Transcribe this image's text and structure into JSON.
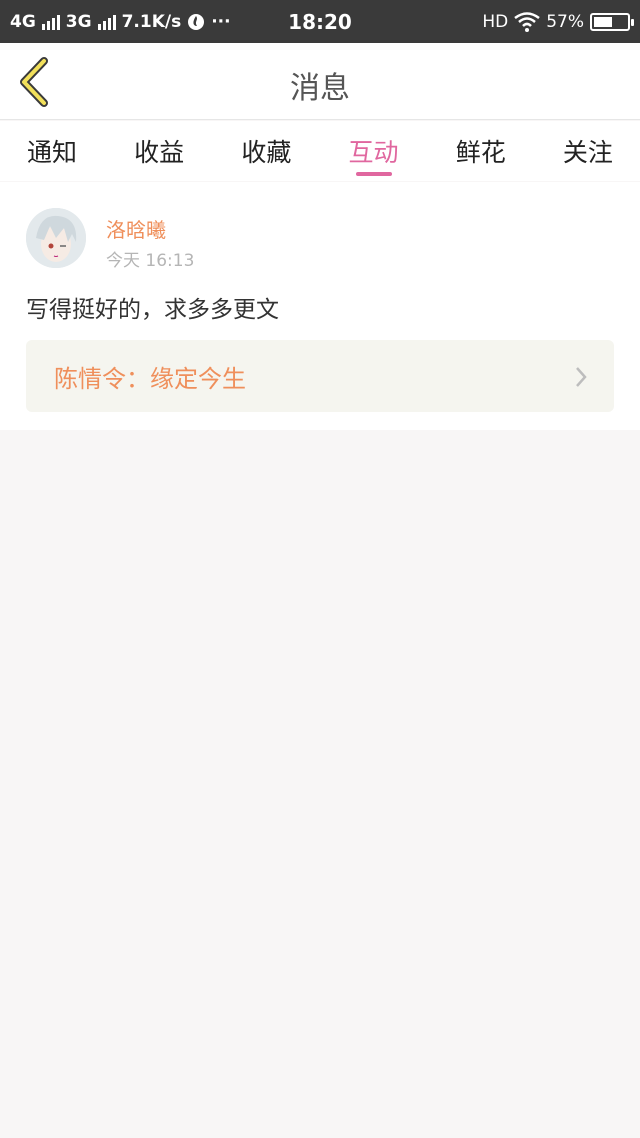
{
  "status_bar": {
    "network1": "4G",
    "network2": "3G",
    "speed": "7.1K/s",
    "dots": "···",
    "time": "18:20",
    "hd": "HD",
    "battery_percent": "57%",
    "battery_level": 0.57
  },
  "nav": {
    "title": "消息"
  },
  "tabs": [
    {
      "label": "通知"
    },
    {
      "label": "收益"
    },
    {
      "label": "收藏"
    },
    {
      "label": "互动"
    },
    {
      "label": "鲜花"
    },
    {
      "label": "关注"
    }
  ],
  "message": {
    "username": "洛晗曦",
    "time": "今天 16:13",
    "comment": "写得挺好的，求多多更文",
    "ref_title": "陈情令：缘定今生"
  },
  "colors": {
    "accent": "#e0679f",
    "username": "#ef8f5b",
    "status_bg": "#3a3a3a"
  }
}
